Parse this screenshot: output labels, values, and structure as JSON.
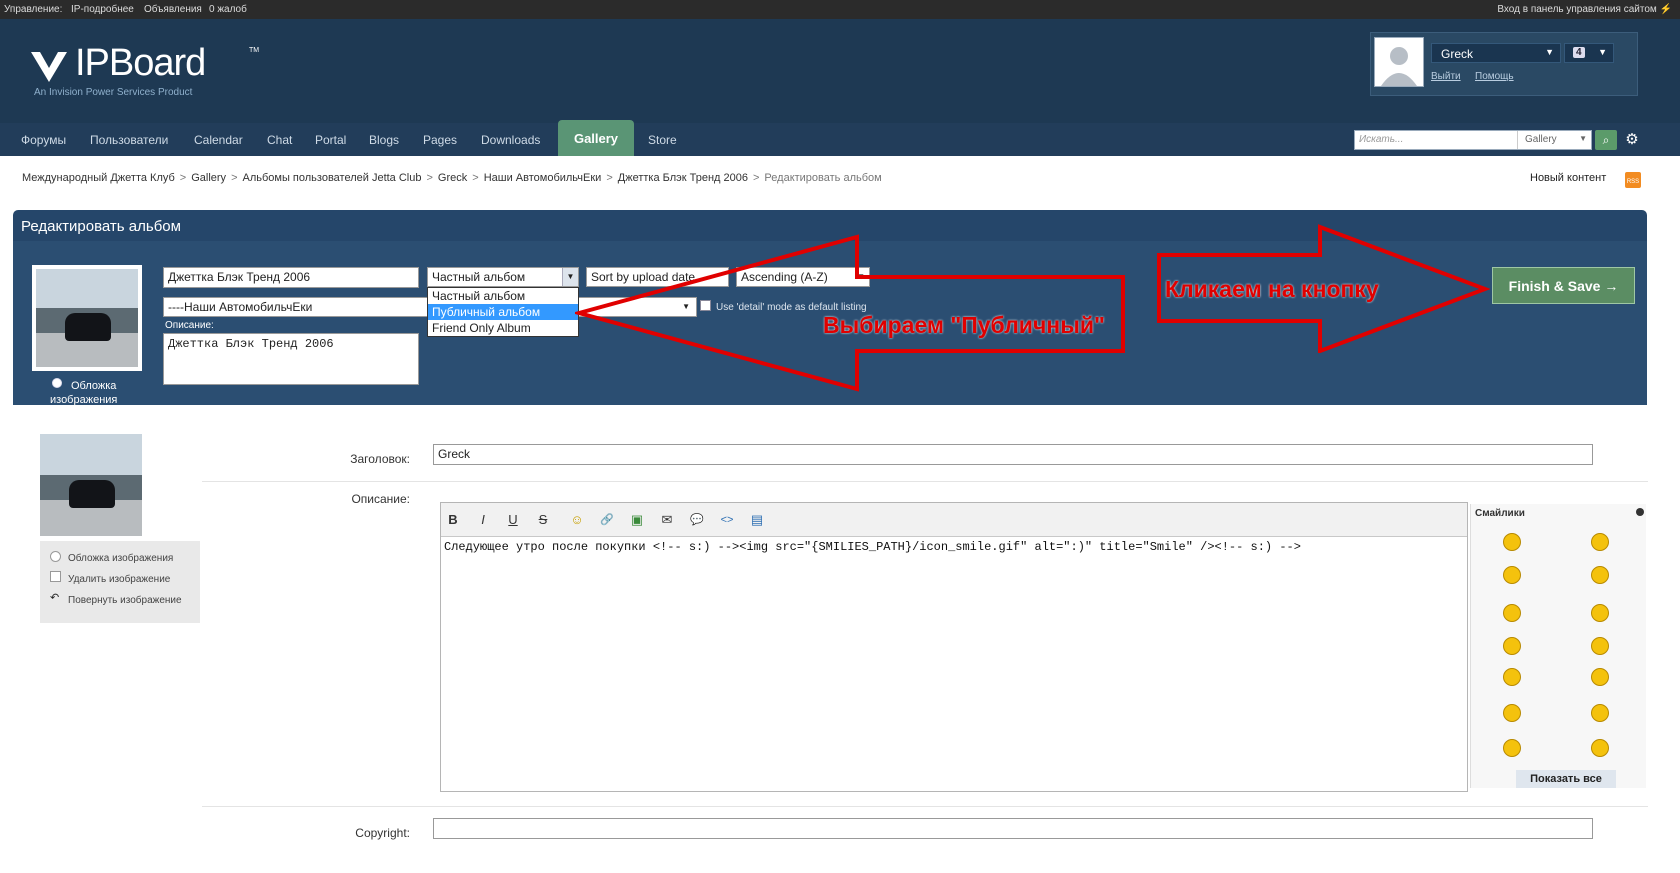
{
  "adminbar": {
    "left_items": [
      "Управление:",
      "IP-подробнее",
      "Объявления",
      "0 жалоб"
    ],
    "right_link": "Вход в панель управления сайтом ⚡"
  },
  "logo": {
    "wordmark": "IPBoard",
    "trademark": "TM",
    "tagline": "An Invision Power Services Product"
  },
  "user": {
    "name": "Greck",
    "badge": "4",
    "logout": "Выйти",
    "help": "Помощь"
  },
  "nav": {
    "items": [
      "Форумы",
      "Пользователи",
      "Calendar",
      "Chat",
      "Portal",
      "Blogs",
      "Pages",
      "Downloads",
      "Gallery",
      "Store"
    ],
    "active": "Gallery",
    "search_placeholder": "Искать...",
    "search_scope": "Gallery"
  },
  "breadcrumb": {
    "items": [
      "Международный Джетта Клуб",
      "Gallery",
      "Альбомы пользователей Jetta Club",
      "Greck",
      "Наши АвтомобильчЕки",
      "Джеттка Блэк Тренд 2006",
      "Редактировать альбом"
    ],
    "separator": ">",
    "new_content": "Новый контент",
    "rss": "RSS"
  },
  "album_panel": {
    "title": "Редактировать альбом",
    "name_value": "Джеттка Блэк Тренд 2006",
    "privacy_value": "Частный альбом",
    "privacy_options": [
      "Частный альбом",
      "Публичный альбом",
      "Friend Only Album"
    ],
    "privacy_highlight": "Публичный альбом",
    "sort_value": "Sort by upload date",
    "order_value": "Ascending (A-Z)",
    "parent_value": "----Наши АвтомобильчЕки",
    "detail_mode_label": "Use 'detail' mode as default listing",
    "description_label": "Описание:",
    "description_value": "Джеттка Блэк Тренд 2006",
    "cover_label_1": "Обложка",
    "cover_label_2": "изображения",
    "finish_button": "Finish & Save →"
  },
  "annotations": {
    "left_text": "Выбираем \"Публичный\"",
    "right_text": "Кликаем на кнопку",
    "color": "#e00000"
  },
  "image_form": {
    "title_label": "Заголовок:",
    "title_value": "Greck",
    "description_label": "Описание:",
    "options": [
      "Обложка изображения",
      "Удалить изображение",
      "Повернуть изображение"
    ],
    "editor_text": "Следующее утро после покупки <!-- s:) --><img src=\"{SMILIES_PATH}/icon_smile.gif\" alt=\":)\" title=\"Smile\" /><!-- s:) -->",
    "toolbar": [
      "B",
      "I",
      "U",
      "S",
      "☺",
      "🔗",
      "▣",
      "✉",
      "💬",
      "<>",
      "▤"
    ],
    "smilies_title": "Смайлики",
    "smilies_show_all": "Показать все",
    "copyright_label": "Copyright:"
  }
}
